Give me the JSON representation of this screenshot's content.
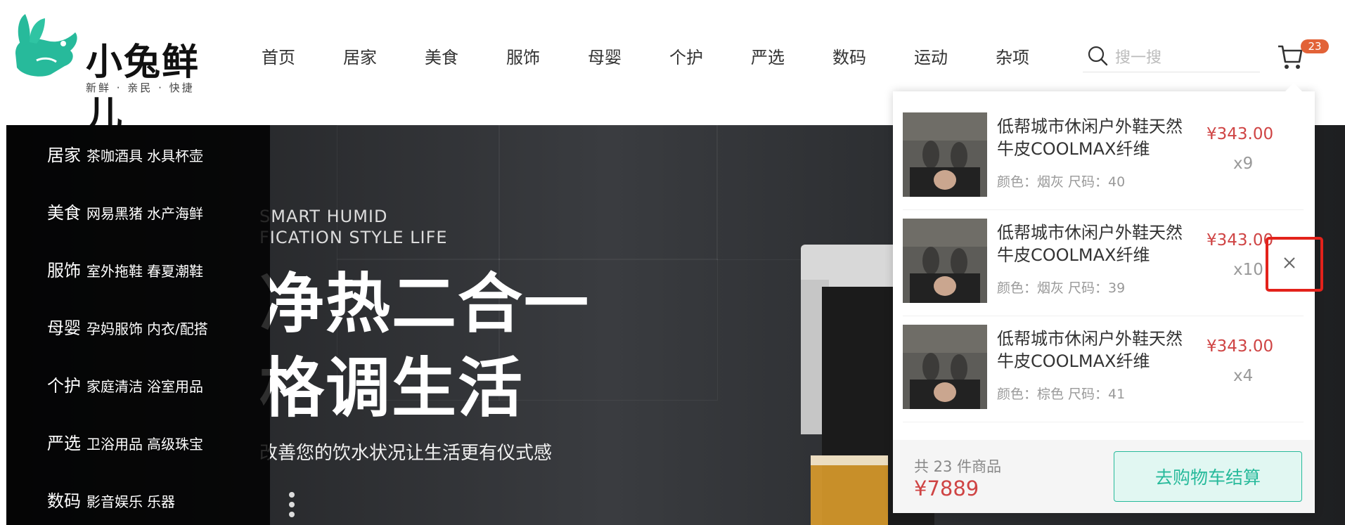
{
  "brand": {
    "name": "小兔鲜儿",
    "slogan": "新鲜 · 亲民 · 快捷",
    "accent_color": "#27ba9b"
  },
  "nav": {
    "items": [
      "首页",
      "居家",
      "美食",
      "服饰",
      "母婴",
      "个护",
      "严选",
      "数码",
      "运动",
      "杂项"
    ]
  },
  "search": {
    "placeholder": "搜一搜",
    "icon": "search-icon"
  },
  "cart": {
    "icon": "cart-icon",
    "badge": "23"
  },
  "categories": [
    {
      "main": "居家",
      "subs": [
        "茶咖酒具",
        "水具杯壶"
      ]
    },
    {
      "main": "美食",
      "subs": [
        "网易黑猪",
        "水产海鲜"
      ]
    },
    {
      "main": "服饰",
      "subs": [
        "室外拖鞋",
        "春夏潮鞋"
      ]
    },
    {
      "main": "母婴",
      "subs": [
        "孕妈服饰",
        "内衣/配搭"
      ]
    },
    {
      "main": "个护",
      "subs": [
        "家庭清洁",
        "浴室用品"
      ]
    },
    {
      "main": "严选",
      "subs": [
        "卫浴用品",
        "高级珠宝"
      ]
    },
    {
      "main": "数码",
      "subs": [
        "影音娱乐",
        "乐器"
      ]
    }
  ],
  "banner": {
    "en_line1": "SMART HUMID",
    "en_line2": "FICATION STYLE LIFE",
    "cn_line1": "净热二合一",
    "cn_line2": "格调生活",
    "cn_sub": "改善您的饮水状况让生活更有仪式感"
  },
  "cart_popup": {
    "items": [
      {
        "name": "低帮城市休闲户外鞋天然牛皮COOLMAX纤维",
        "attrs": "颜色：烟灰 尺码：40",
        "price": "¥343.00",
        "qty": "x9"
      },
      {
        "name": "低帮城市休闲户外鞋天然牛皮COOLMAX纤维",
        "attrs": "颜色：烟灰 尺码：39",
        "price": "¥343.00",
        "qty": "x10"
      },
      {
        "name": "低帮城市休闲户外鞋天然牛皮COOLMAX纤维",
        "attrs": "颜色：棕色 尺码：41",
        "price": "¥343.00",
        "qty": "x4"
      }
    ],
    "total_count": "共 23 件商品",
    "total_price": "¥7889",
    "checkout_label": "去购物车结算",
    "price_color": "#cf4444",
    "highlight_color": "#e3221b"
  }
}
